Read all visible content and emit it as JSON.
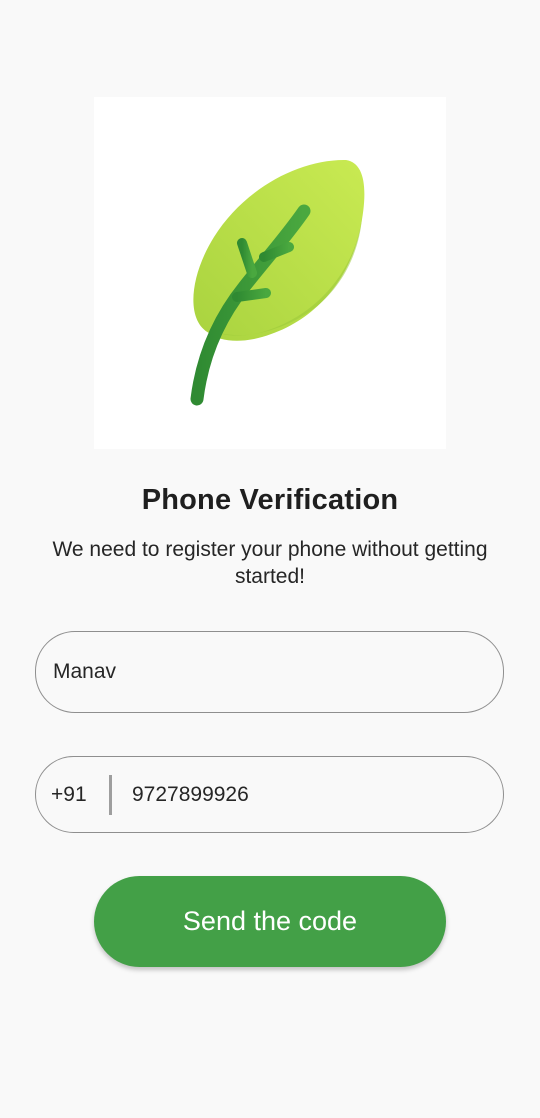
{
  "illustration": {
    "icon": "leaf-icon",
    "colors": {
      "leaf_light": "#c5e84f",
      "leaf_mid": "#a6d33f",
      "stem": "#3f9a37"
    }
  },
  "header": {
    "title": "Phone Verification",
    "subtitle": "We need to register your phone without getting started!"
  },
  "form": {
    "name": {
      "value": "Manav"
    },
    "phone": {
      "country_code": "+91",
      "value": "9727899926"
    },
    "submit_label": "Send the code"
  },
  "colors": {
    "background": "#f9f9f9",
    "accent": "#43a047",
    "border": "#8f8f8f"
  }
}
